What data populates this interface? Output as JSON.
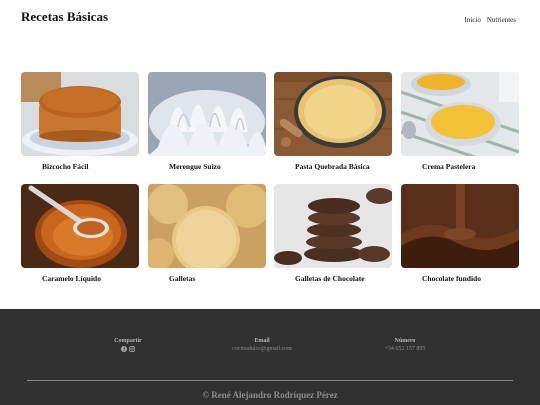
{
  "header": {
    "title": "Recetas Básicas",
    "nav": [
      {
        "label": "Inicio"
      },
      {
        "label": "Nutrientes"
      }
    ]
  },
  "recipes": [
    {
      "name": "Bizcocho Fácil",
      "image": "sponge-cake-photo"
    },
    {
      "name": "Merengue Suizo",
      "image": "meringue-photo"
    },
    {
      "name": "Pasta Quebrada Básica",
      "image": "tart-shell-photo"
    },
    {
      "name": "Crema Pastelera",
      "image": "pastry-cream-photo"
    },
    {
      "name": "Caramelo Líquido",
      "image": "caramel-photo"
    },
    {
      "name": "Galletas",
      "image": "cookies-photo"
    },
    {
      "name": "Galletas de Chocolate",
      "image": "chocolate-cookies-photo"
    },
    {
      "name": "Chocolate fundido",
      "image": "melted-chocolate-photo"
    }
  ],
  "footer": {
    "share_label": "Compartir",
    "social_icons": [
      "facebook-icon",
      "instagram-icon"
    ],
    "email_label": "Email",
    "email_value": "cocinadulce@gmail.com",
    "phone_label": "Número",
    "phone_value": "+34 652 157 895",
    "copyright": "© René Alejandro Rodríquez Pérez"
  }
}
